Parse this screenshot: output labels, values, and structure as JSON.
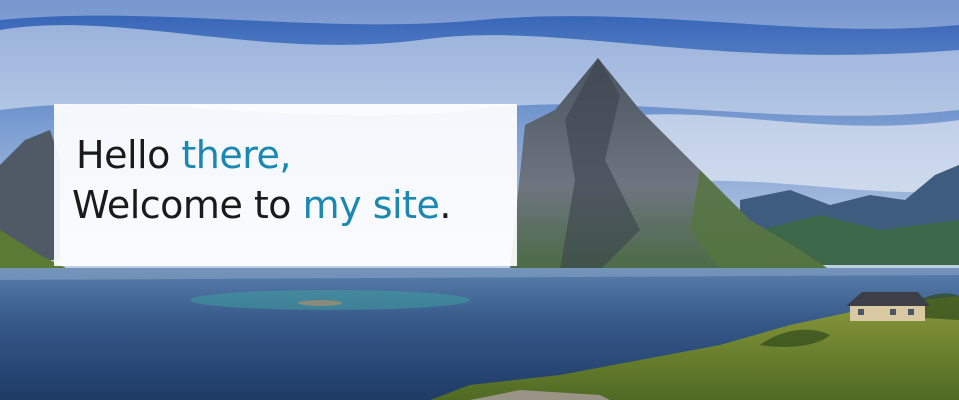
{
  "hero": {
    "line1": {
      "plain": "Hello ",
      "accent": "there,"
    },
    "line2": {
      "plain": "Welcome to ",
      "accent": "my site",
      "end": "."
    }
  },
  "colors": {
    "accent": "#1a88b0",
    "text": "#1a1a1a",
    "sky_top": "#2f5fb5",
    "water": "#2a4d80"
  },
  "background_image": "mountain-lake-landscape"
}
